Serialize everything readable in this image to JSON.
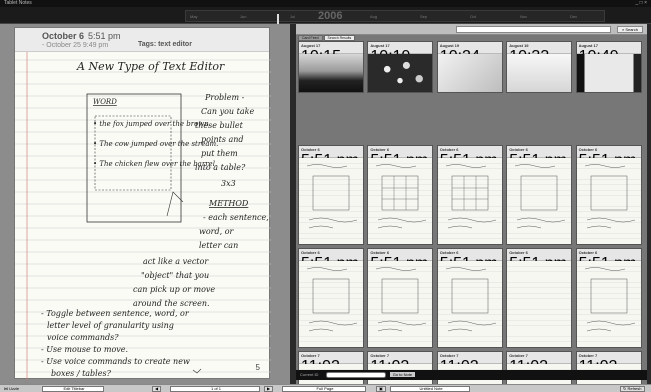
{
  "window": {
    "title": "Tablet Notes",
    "controls": "_ □ ×"
  },
  "timeline": {
    "year": "2006",
    "ticks": [
      "May",
      "Jun",
      "Jul",
      "Aug",
      "Sep",
      "Oct",
      "Nov",
      "Dec"
    ]
  },
  "note": {
    "date": "October 6",
    "time": "5:51 pm",
    "date2": "- October 25  9:49 pm",
    "tags": "Tags: text editor",
    "page_number": "5",
    "handwriting": {
      "title": "A New Type of Text Editor",
      "word_heading": "WORD",
      "bullets": [
        "• the fox jumped over the brown",
        "• The cow jumped over the stream.",
        "• The chicken flew over the barrel."
      ],
      "problem": [
        "Problem -",
        "Can you take",
        "these bullet",
        "points and",
        "put them",
        "into a table?",
        "3x3"
      ],
      "method_heading": "METHOD",
      "method": [
        "- each sentence,",
        "word, or",
        "letter can",
        "act like a vector",
        "\"object\" that you",
        "can pick up or move",
        "around the screen."
      ],
      "bottom": [
        "- Toggle between sentence, word, or",
        "letter level of granularity using",
        "voice commands?",
        "- Use mouse to move.",
        "- Use voice commands to create new",
        "boxes / tables?"
      ]
    }
  },
  "search": {
    "placeholder": "",
    "button": "Search"
  },
  "tabs": [
    "Card Feed",
    "Search Results"
  ],
  "cards": [
    {
      "date": "August 17",
      "time": "10:15 pm",
      "tags": "Tags: text editor",
      "kind": "photo-dark"
    },
    {
      "date": "August 17",
      "time": "10:19 pm",
      "tags": "Tags: text editor",
      "kind": "photo-flowers"
    },
    {
      "date": "August 19",
      "time": "10:24 pm",
      "tags": "Tags: text editor",
      "kind": "photo-whiteboard"
    },
    {
      "date": "August 19",
      "time": "10:33 pm",
      "tags": "Tags: text editor",
      "kind": "photo-light"
    },
    {
      "date": "August 17",
      "time": "10:49 pm",
      "tags": "Tags: text",
      "kind": "photo-board"
    },
    {
      "date": "October 6",
      "time": "5:51 pm",
      "tags": "Tags: text editor",
      "kind": "sketch"
    },
    {
      "date": "October 6",
      "time": "5:51 pm",
      "tags": "Tags: text editor",
      "kind": "sketch-grid"
    },
    {
      "date": "October 6",
      "time": "5:51 pm",
      "tags": "Tags: text editor",
      "kind": "sketch-grid"
    },
    {
      "date": "October 6",
      "time": "5:51 pm",
      "tags": "Tags: text editor",
      "kind": "sketch"
    },
    {
      "date": "October 6",
      "time": "5:51 pm",
      "tags": "Tags: text editor",
      "kind": "sketch"
    },
    {
      "date": "October 6",
      "time": "5:51 pm",
      "tags": "Tags: text editor",
      "kind": "sketch"
    },
    {
      "date": "October 6",
      "time": "5:51 pm",
      "tags": "Tags: text editor",
      "kind": "sketch"
    },
    {
      "date": "October 6",
      "time": "5:51 pm",
      "tags": "Tags: text editor",
      "kind": "sketch"
    },
    {
      "date": "October 6",
      "time": "5:51 pm",
      "tags": "Tags: text editor",
      "kind": "blank"
    },
    {
      "date": "October 6",
      "time": "5:51 pm",
      "tags": "Tags: text editor",
      "kind": "sketch"
    },
    {
      "date": "October 7",
      "time": "11:02 am",
      "tags": "Tags: text editor",
      "kind": "blank"
    },
    {
      "date": "October 7",
      "time": "11:02 am",
      "tags": "Tags: text editor",
      "kind": "blank"
    },
    {
      "date": "October 7",
      "time": "11:02 am",
      "tags": "Tags: text editor",
      "kind": "blank"
    },
    {
      "date": "October 7",
      "time": "11:02 am",
      "tags": "Tags: text editor",
      "kind": "blank"
    },
    {
      "date": "October 7",
      "time": "11:02 am",
      "tags": "Tags: text editor",
      "kind": "blank"
    }
  ],
  "status_strip": {
    "label": "Current ID",
    "value": "",
    "button": "Go to Note"
  },
  "bottom_bar": {
    "app_label": "Uzzle",
    "view_field": "Edit Titlebar",
    "page_field": "1 of 1",
    "paper_field": "Full Page",
    "note_field": "Untitled Note",
    "refresh": "Refresh"
  },
  "colors": {
    "page": "#fbfbf6",
    "ruled_line": "#c9c9c9",
    "margin_line": "#d08080",
    "ink": "#222222"
  }
}
